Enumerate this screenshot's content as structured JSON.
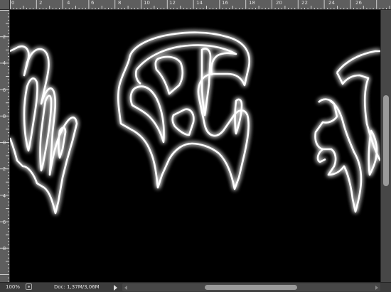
{
  "rulers": {
    "top_labels": [
      "0",
      "2",
      "4",
      "6",
      "8",
      "10",
      "12",
      "14",
      "16",
      "18",
      "20",
      "22",
      "24",
      "26"
    ],
    "left_labels": [
      "2",
      "4",
      "6",
      "8",
      "0",
      "2",
      "4",
      "6",
      "8"
    ]
  },
  "status_bar": {
    "zoom": "100%",
    "doc_info": "Doc: 1,37M/3,06M"
  },
  "canvas": {
    "background": "#000000",
    "glow_color": "#ffffff",
    "description_icon": "glowing-text-artwork"
  }
}
